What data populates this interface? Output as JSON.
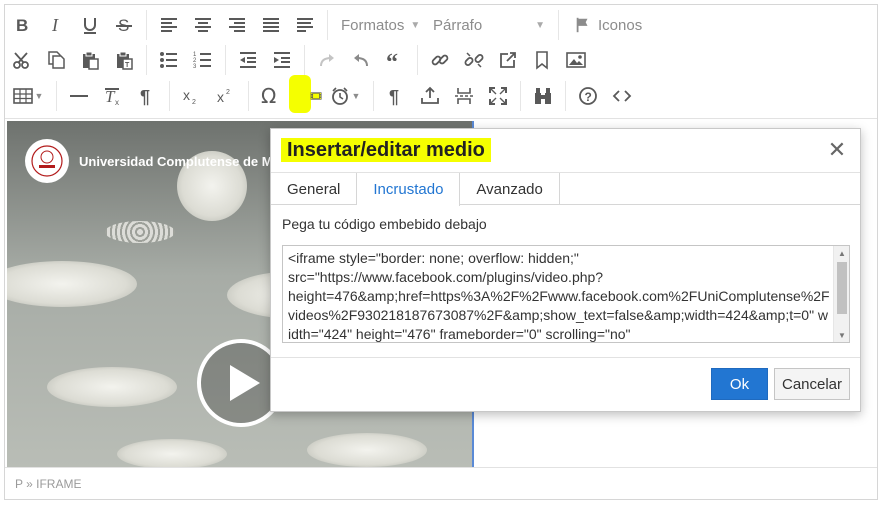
{
  "toolbar": {
    "formats_label": "Formatos",
    "paragraph_label": "Párrafo",
    "icons_label": "Iconos",
    "highlight_color": "#f5ff00"
  },
  "video": {
    "channel_name": "Universidad Complutense de Ma"
  },
  "statusbar": {
    "path": "P » IFRAME"
  },
  "dialog": {
    "title": "Insertar/editar medio",
    "tabs": [
      {
        "label": "General"
      },
      {
        "label": "Incrustado"
      },
      {
        "label": "Avanzado"
      }
    ],
    "active_tab": "Incrustado",
    "embed_label": "Pega tu código embebido debajo",
    "embed_code": "<iframe style=\"border: none; overflow: hidden;\"\nsrc=\"https://www.facebook.com/plugins/video.php?\nheight=476&amp;href=https%3A%2F%2Fwww.facebook.com%2FUniComplutense%2Fvideos%2F930218187673087%2F&amp;show_text=false&amp;width=424&amp;t=0\" width=\"424\" height=\"476\" frameborder=\"0\" scrolling=\"no\"",
    "ok_label": "Ok",
    "cancel_label": "Cancelar",
    "accent_color": "#2276d2"
  }
}
